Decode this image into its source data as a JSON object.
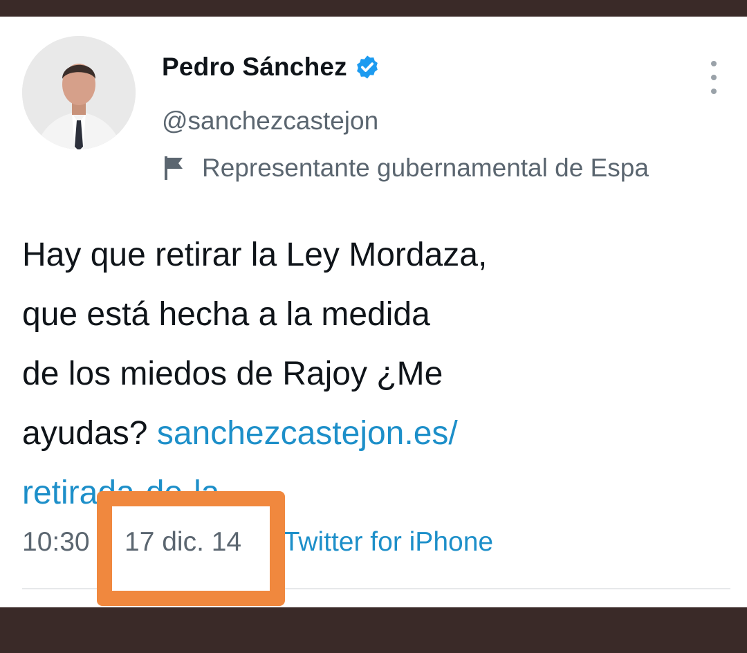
{
  "tweet": {
    "author_name": "Pedro Sánchez",
    "handle": "@sanchezcastejon",
    "account_label": "Representante gubernamental de Espa",
    "text_lines": [
      "Hay que retirar la Ley Mordaza,",
      "que está hecha a la medida",
      "de los miedos de Rajoy ¿Me"
    ],
    "text_last_prefix": "ayudas? ",
    "link_line1": "sanchezcastejon.es/",
    "link_line2": "retirada-de-la…",
    "time": "10:30",
    "date": "17 dic. 14",
    "source": "Twitter for iPhone"
  },
  "icons": {
    "verified": "verified-badge-icon",
    "flag": "flag-icon",
    "more": "more-vertical-icon"
  },
  "colors": {
    "link": "#1d8fc9",
    "highlight": "#f0883e",
    "background_frame": "#3a2a28"
  }
}
